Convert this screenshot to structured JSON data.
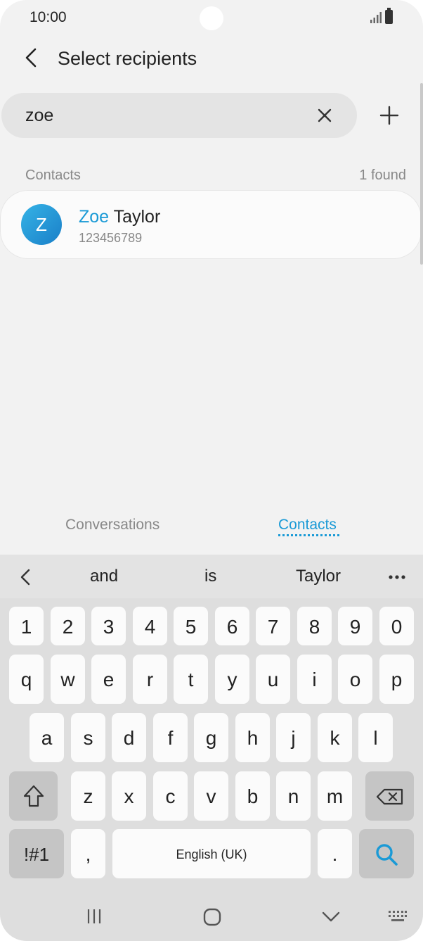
{
  "status_bar": {
    "time": "10:00"
  },
  "header": {
    "title": "Select recipients"
  },
  "search": {
    "value": "zoe"
  },
  "results": {
    "section_label": "Contacts",
    "count_label": "1 found"
  },
  "contact": {
    "avatar_letter": "Z",
    "name_highlight": "Zoe",
    "name_rest": " Taylor",
    "number": "123456789"
  },
  "tabs": {
    "conversations": "Conversations",
    "contacts": "Contacts"
  },
  "suggestions": [
    "and",
    "is",
    "Taylor"
  ],
  "keyboard": {
    "row_numbers": [
      "1",
      "2",
      "3",
      "4",
      "5",
      "6",
      "7",
      "8",
      "9",
      "0"
    ],
    "row_1": [
      "q",
      "w",
      "e",
      "r",
      "t",
      "y",
      "u",
      "i",
      "o",
      "p"
    ],
    "row_2": [
      "a",
      "s",
      "d",
      "f",
      "g",
      "h",
      "j",
      "k",
      "l"
    ],
    "row_3": [
      "z",
      "x",
      "c",
      "v",
      "b",
      "n",
      "m"
    ],
    "symbols_key": "!#1",
    "comma_key": ",",
    "space_key": "English (UK)",
    "period_key": "."
  },
  "colors": {
    "accent": "#1a9ad6",
    "search_key": "#1a9ad6"
  }
}
